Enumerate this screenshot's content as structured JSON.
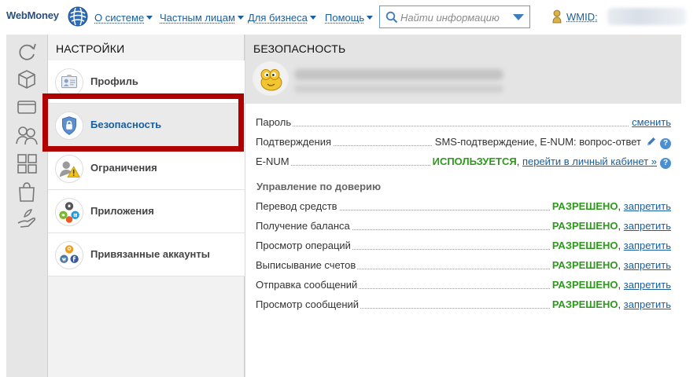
{
  "header": {
    "logo_text": "WebMoney",
    "nav": [
      {
        "label": "О системе"
      },
      {
        "label": "Частным лицам"
      },
      {
        "label": "Для бизнеса"
      },
      {
        "label": "Помощь"
      }
    ],
    "search": {
      "placeholder": "Найти информацию"
    },
    "wmid_label": "WMID:"
  },
  "sidebar_icons": [
    "refresh-icon",
    "box-icon",
    "wallet-icon",
    "contacts-icon",
    "services-icon",
    "shopping-bag-icon",
    "hand-icon"
  ],
  "settings": {
    "title": "НАСТРОЙКИ",
    "items": [
      {
        "label": "Профиль",
        "icon": "profile-card-icon"
      },
      {
        "label": "Безопасность",
        "icon": "shield-lock-icon",
        "active": true
      },
      {
        "label": "Ограничения",
        "icon": "restriction-warning-icon"
      },
      {
        "label": "Приложения",
        "icon": "apps-platforms-icon"
      },
      {
        "label": "Привязанные аккаунты",
        "icon": "social-accounts-icon"
      }
    ]
  },
  "security": {
    "title": "БЕЗОПАСНОСТЬ",
    "rows": [
      {
        "label": "Пароль",
        "link": "сменить"
      },
      {
        "label": "Подтверждения",
        "value": "SMS-подтверждение, E-NUM: вопрос-ответ"
      },
      {
        "label": "E-NUM",
        "status": "ИСПОЛЬЗУЕТСЯ",
        "separator": ",",
        "link": "перейти в личный кабинет »"
      }
    ],
    "trust": {
      "title": "Управление по доверию",
      "rows": [
        {
          "label": "Перевод средств",
          "status": "РАЗРЕШЕНО",
          "separator": ",",
          "link": "запретить"
        },
        {
          "label": "Получение баланса",
          "status": "РАЗРЕШЕНО",
          "separator": ",",
          "link": "запретить"
        },
        {
          "label": "Просмотр операций",
          "status": "РАЗРЕШЕНО",
          "separator": ",",
          "link": "запретить"
        },
        {
          "label": "Выписывание счетов",
          "status": "РАЗРЕШЕНО",
          "separator": ",",
          "link": "запретить"
        },
        {
          "label": "Отправка сообщений",
          "status": "РАЗРЕШЕНО",
          "separator": ",",
          "link": "запретить"
        },
        {
          "label": "Просмотр сообщений",
          "status": "РАЗРЕШЕНО",
          "separator": ",",
          "link": "запретить"
        }
      ]
    },
    "help_mark": "?"
  },
  "colors": {
    "accent": "#1a5fa0",
    "status_green": "#2c9a1a",
    "highlight_red": "#b00000"
  }
}
